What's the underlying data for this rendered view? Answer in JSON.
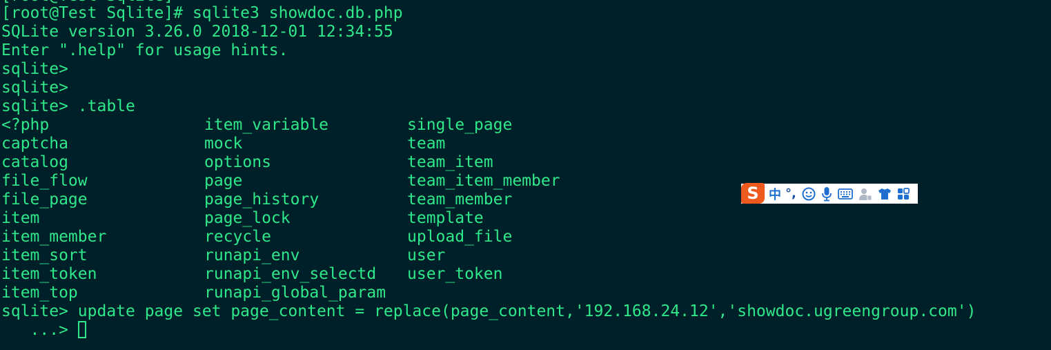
{
  "terminal": {
    "clipped_top_line": "[root@Test Sqlite]",
    "lines": [
      "[root@Test Sqlite]# sqlite3 showdoc.db.php",
      "SQLite version 3.26.0 2018-12-01 12:34:55",
      "Enter \".help\" for usage hints.",
      "sqlite>",
      "sqlite>",
      "sqlite> .table"
    ],
    "tables": {
      "col1": [
        "<?php",
        "captcha",
        "catalog",
        "file_flow",
        "file_page",
        "item",
        "item_member",
        "item_sort",
        "item_token",
        "item_top"
      ],
      "col2": [
        "item_variable",
        "mock",
        "options",
        "page",
        "page_history",
        "page_lock",
        "recycle",
        "runapi_env",
        "runapi_env_selectd",
        "runapi_global_param"
      ],
      "col3": [
        "single_page",
        "team",
        "team_item",
        "team_item_member",
        "team_member",
        "template",
        "upload_file",
        "user",
        "user_token"
      ]
    },
    "command_line": "sqlite> update page set page_content = replace(page_content,'192.168.24.12','showdoc.ugreengroup.com')",
    "continuation_prompt": "   ...> ",
    "text_color": "#2ee88a",
    "background_color": "#002029"
  },
  "ime_toolbar": {
    "logo_letter": "S",
    "mode_label": "中",
    "punctuation_label": "°,",
    "icons": [
      "sogou-logo-icon",
      "chinese-mode-icon",
      "punctuation-icon",
      "emoji-icon",
      "microphone-icon",
      "keyboard-icon",
      "user-icon",
      "skin-shirt-icon",
      "toolbox-grid-icon"
    ],
    "accent_color": "#1f6fd1",
    "logo_color": "#ee5a1e"
  }
}
